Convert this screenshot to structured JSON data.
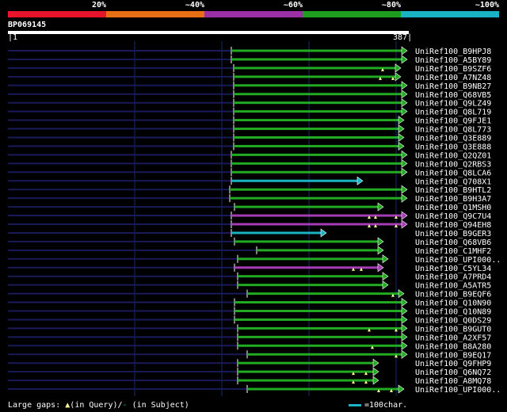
{
  "legend": {
    "segments": [
      {
        "color": "#e8142c"
      },
      {
        "color": "#e86f14"
      },
      {
        "color": "#9c2fa6"
      },
      {
        "color": "#1e9e1e"
      },
      {
        "color": "#1ab3c4"
      }
    ],
    "labels": [
      "20%",
      "~40%",
      "~60%",
      "~80%",
      "~100%"
    ]
  },
  "query": {
    "name": "BP069145",
    "start": "1",
    "end": "387"
  },
  "colors": {
    "green": "#22aa22",
    "cyan": "#1ab3c4",
    "purple": "#a43cb4",
    "navy": "#1a1a5a",
    "marker": "#ffff99"
  },
  "hits": [
    {
      "label": "UniRef100_B9HPJ8",
      "start": 292,
      "end": 514,
      "color": "green",
      "gaps": []
    },
    {
      "label": "UniRef100_A5BY89",
      "start": 292,
      "end": 514,
      "color": "green",
      "gaps": []
    },
    {
      "label": "UniRef100_B9SZF6",
      "start": 295,
      "end": 506,
      "color": "green",
      "gaps": [
        483
      ]
    },
    {
      "label": "UniRef100_A7NZ48",
      "start": 295,
      "end": 506,
      "color": "green",
      "gaps": [
        480,
        496
      ]
    },
    {
      "label": "UniRef100_B9NB27",
      "start": 295,
      "end": 514,
      "color": "green",
      "gaps": []
    },
    {
      "label": "UniRef100_Q68VB5",
      "start": 295,
      "end": 514,
      "color": "green",
      "gaps": []
    },
    {
      "label": "UniRef100_Q9LZ49",
      "start": 295,
      "end": 514,
      "color": "green",
      "gaps": []
    },
    {
      "label": "UniRef100_Q8L719",
      "start": 295,
      "end": 514,
      "color": "green",
      "gaps": []
    },
    {
      "label": "UniRef100_Q9FJE1",
      "start": 295,
      "end": 510,
      "color": "green",
      "gaps": []
    },
    {
      "label": "UniRef100_Q8L773",
      "start": 295,
      "end": 510,
      "color": "green",
      "gaps": []
    },
    {
      "label": "UniRef100_Q3E889",
      "start": 295,
      "end": 510,
      "color": "green",
      "gaps": []
    },
    {
      "label": "UniRef100_Q3E888",
      "start": 295,
      "end": 510,
      "color": "green",
      "gaps": []
    },
    {
      "label": "UniRef100_Q2QZ01",
      "start": 292,
      "end": 514,
      "color": "green",
      "gaps": []
    },
    {
      "label": "UniRef100_Q2RBS3",
      "start": 292,
      "end": 514,
      "color": "green",
      "gaps": []
    },
    {
      "label": "UniRef100_Q8LCA6",
      "start": 292,
      "end": 514,
      "color": "green",
      "gaps": []
    },
    {
      "label": "UniRef100_Q708X1",
      "start": 292,
      "end": 458,
      "color": "cyan",
      "gaps": []
    },
    {
      "label": "UniRef100_B9HTL2",
      "start": 290,
      "end": 514,
      "color": "green",
      "gaps": []
    },
    {
      "label": "UniRef100_B9H3A7",
      "start": 290,
      "end": 514,
      "color": "green",
      "gaps": []
    },
    {
      "label": "UniRef100_Q1MSH0",
      "start": 296,
      "end": 484,
      "color": "green",
      "gaps": []
    },
    {
      "label": "UniRef100_Q9C7U4",
      "start": 292,
      "end": 514,
      "color": "purple",
      "gaps": [
        466,
        474,
        500
      ]
    },
    {
      "label": "UniRef100_Q94EH8",
      "start": 292,
      "end": 514,
      "color": "purple",
      "gaps": [
        466,
        474,
        500
      ]
    },
    {
      "label": "UniRef100_B9GER3",
      "start": 292,
      "end": 412,
      "color": "cyan",
      "gaps": []
    },
    {
      "label": "UniRef100_Q68VB6",
      "start": 296,
      "end": 484,
      "color": "green",
      "gaps": []
    },
    {
      "label": "UniRef100_C1MHF2",
      "start": 324,
      "end": 484,
      "color": "green",
      "gaps": []
    },
    {
      "label": "UniRef100_UPI000..",
      "start": 300,
      "end": 490,
      "color": "green",
      "gaps": []
    },
    {
      "label": "UniRef100_C5YL34",
      "start": 296,
      "end": 484,
      "color": "purple",
      "gaps": [
        446,
        456
      ]
    },
    {
      "label": "UniRef100_A7PRD4",
      "start": 300,
      "end": 490,
      "color": "green",
      "gaps": []
    },
    {
      "label": "UniRef100_A5ATR5",
      "start": 300,
      "end": 490,
      "color": "green",
      "gaps": []
    },
    {
      "label": "UniRef100_B9EQF6",
      "start": 312,
      "end": 510,
      "color": "green",
      "gaps": [
        496
      ]
    },
    {
      "label": "UniRef100_Q10N90",
      "start": 296,
      "end": 514,
      "color": "green",
      "gaps": []
    },
    {
      "label": "UniRef100_Q10N89",
      "start": 296,
      "end": 514,
      "color": "green",
      "gaps": []
    },
    {
      "label": "UniRef100_Q0DS29",
      "start": 296,
      "end": 514,
      "color": "green",
      "gaps": []
    },
    {
      "label": "UniRef100_B9GUT0",
      "start": 300,
      "end": 514,
      "color": "green",
      "gaps": [
        466,
        500
      ]
    },
    {
      "label": "UniRef100_A2XF57",
      "start": 300,
      "end": 514,
      "color": "green",
      "gaps": []
    },
    {
      "label": "UniRef100_B8A280",
      "start": 300,
      "end": 514,
      "color": "green",
      "gaps": [
        470
      ]
    },
    {
      "label": "UniRef100_B9EQ17",
      "start": 312,
      "end": 514,
      "color": "green",
      "gaps": [
        500
      ]
    },
    {
      "label": "UniRef100_Q9FHP9",
      "start": 300,
      "end": 478,
      "color": "green",
      "gaps": []
    },
    {
      "label": "UniRef100_Q6NQ72",
      "start": 300,
      "end": 478,
      "color": "green",
      "gaps": [
        446,
        462
      ]
    },
    {
      "label": "UniRef100_A8MQ78",
      "start": 300,
      "end": 478,
      "color": "green",
      "gaps": [
        446,
        462
      ]
    },
    {
      "label": "UniRef100_UPI000..",
      "start": 312,
      "end": 510,
      "color": "green",
      "gaps": [
        478,
        494
      ]
    }
  ],
  "footer": {
    "gaps_label": "Large gaps:",
    "gaps_query": "(in Query)/",
    "gaps_subject_mark": "-",
    "gaps_subject": " (in Subject)",
    "scale_label": "=100char."
  }
}
